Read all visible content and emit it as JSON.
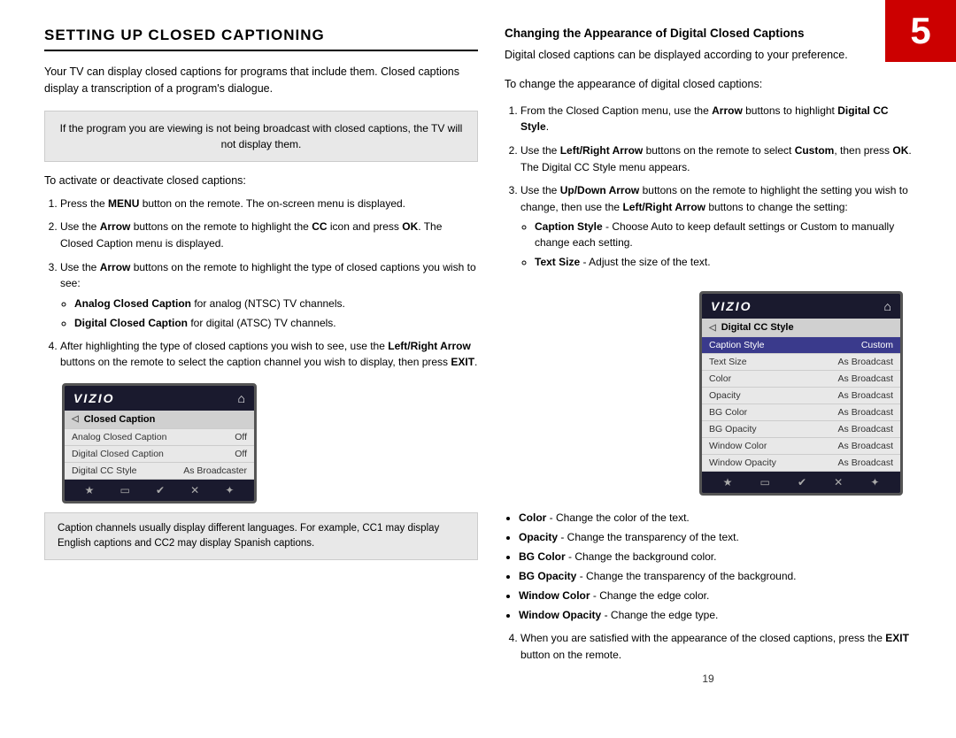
{
  "badge": {
    "number": "5"
  },
  "left": {
    "title": "SETTING UP CLOSED CAPTIONING",
    "intro": "Your TV can display closed captions for programs that include them. Closed captions display a transcription of a program's dialogue.",
    "info_box": "If the program you are viewing is not being broadcast with closed captions, the TV will not display them.",
    "steps_intro": "To activate or deactivate closed captions:",
    "steps": [
      {
        "id": 1,
        "text_parts": [
          {
            "text": "Press the ",
            "bold": false
          },
          {
            "text": "MENU",
            "bold": true
          },
          {
            "text": " button on the remote. The on-screen menu is displayed.",
            "bold": false
          }
        ]
      },
      {
        "id": 2,
        "text_parts": [
          {
            "text": "Use the ",
            "bold": false
          },
          {
            "text": "Arrow",
            "bold": true
          },
          {
            "text": " buttons on the remote to highlight the ",
            "bold": false
          },
          {
            "text": "CC",
            "bold": true
          },
          {
            "text": " icon and press ",
            "bold": false
          },
          {
            "text": "OK",
            "bold": true
          },
          {
            "text": ". The Closed Caption menu is displayed.",
            "bold": false
          }
        ]
      },
      {
        "id": 3,
        "text_parts": [
          {
            "text": "Use the ",
            "bold": false
          },
          {
            "text": "Arrow",
            "bold": true
          },
          {
            "text": " buttons on the remote to highlight the type of closed captions you wish to see:",
            "bold": false
          }
        ],
        "bullets": [
          {
            "bold_text": "Analog Closed Caption",
            "rest": " for analog (NTSC) TV channels."
          },
          {
            "bold_text": "Digital Closed Caption",
            "rest": " for digital (ATSC) TV channels."
          }
        ]
      },
      {
        "id": 4,
        "text_parts": [
          {
            "text": "After highlighting the type of closed captions you wish to see, use the ",
            "bold": false
          },
          {
            "text": "Left/Right Arrow",
            "bold": true
          },
          {
            "text": " buttons on the remote to select the caption channel you wish to display, then press ",
            "bold": false
          },
          {
            "text": "EXIT",
            "bold": true
          },
          {
            "text": ".",
            "bold": false
          }
        ]
      }
    ],
    "bottom_note": "Caption channels usually display different languages. For example, CC1 may display English captions and CC2 may display Spanish captions.",
    "tv_menu": {
      "logo": "VIZIO",
      "header_label": "Closed Caption",
      "rows": [
        {
          "label": "Analog Closed Caption",
          "value": "Off"
        },
        {
          "label": "Digital Closed Caption",
          "value": "Off"
        },
        {
          "label": "Digital CC Style",
          "value": "As Broadcaster"
        }
      ],
      "footer_icons": [
        "★",
        "▭",
        "✔",
        "✕",
        "✦"
      ]
    }
  },
  "right": {
    "heading": "Changing the Appearance of Digital Closed Captions",
    "intro1": "Digital closed captions can be displayed according to your preference.",
    "intro2": "To change the appearance of digital closed captions:",
    "steps": [
      {
        "id": 1,
        "text_parts": [
          {
            "text": "From the Closed Caption menu, use the ",
            "bold": false
          },
          {
            "text": "Arrow",
            "bold": true
          },
          {
            "text": " buttons to highlight ",
            "bold": false
          },
          {
            "text": "Digital CC Style",
            "bold": true
          },
          {
            "text": ".",
            "bold": false
          }
        ]
      },
      {
        "id": 2,
        "text_parts": [
          {
            "text": "Use the ",
            "bold": false
          },
          {
            "text": "Left/Right Arrow",
            "bold": true
          },
          {
            "text": " buttons on the remote to select ",
            "bold": false
          },
          {
            "text": "Custom",
            "bold": true
          },
          {
            "text": ", then press ",
            "bold": false
          },
          {
            "text": "OK",
            "bold": true
          },
          {
            "text": ". The Digital CC Style menu appears.",
            "bold": false
          }
        ]
      },
      {
        "id": 3,
        "text_parts": [
          {
            "text": "Use the ",
            "bold": false
          },
          {
            "text": "Up/Down Arrow",
            "bold": true
          },
          {
            "text": " buttons on the remote to highlight the setting you wish to change, then use the ",
            "bold": false
          },
          {
            "text": "Left/Right Arrow",
            "bold": true
          },
          {
            "text": " buttons to change the setting:",
            "bold": false
          }
        ],
        "bullets": [
          {
            "bold_text": "Caption Style",
            "rest": " - Choose Auto to keep default settings or Custom to manually change each setting."
          },
          {
            "bold_text": "Text Size",
            "rest": " - Adjust the size of the text."
          }
        ]
      }
    ],
    "extra_bullets": [
      {
        "bold_text": "Color",
        "rest": " - Change the color of the text."
      },
      {
        "bold_text": "Opacity",
        "rest": " - Change the transparency of the text."
      },
      {
        "bold_text": "BG Color",
        "rest": " - Change the background color."
      },
      {
        "bold_text": "BG Opacity",
        "rest": " - Change the transparency of the background."
      },
      {
        "bold_text": "Window Color",
        "rest": " - Change the edge color."
      },
      {
        "bold_text": "Window Opacity",
        "rest": " - Change the edge type."
      }
    ],
    "step4": {
      "id": 4,
      "text_parts": [
        {
          "text": "When you are satisfied with the appearance of the closed captions, press the ",
          "bold": false
        },
        {
          "text": "EXIT",
          "bold": true
        },
        {
          "text": " button on the remote.",
          "bold": false
        }
      ]
    },
    "tv_menu": {
      "logo": "VIZIO",
      "header_label": "Digital CC Style",
      "rows": [
        {
          "label": "Caption Style",
          "value": "Custom",
          "highlight": true
        },
        {
          "label": "Text Size",
          "value": "As Broadcast"
        },
        {
          "label": "Color",
          "value": "As Broadcast"
        },
        {
          "label": "Opacity",
          "value": "As Broadcast"
        },
        {
          "label": "BG Color",
          "value": "As Broadcast"
        },
        {
          "label": "BG Opacity",
          "value": "As Broadcast"
        },
        {
          "label": "Window Color",
          "value": "As Broadcast"
        },
        {
          "label": "Window Opacity",
          "value": "As Broadcast"
        }
      ],
      "footer_icons": [
        "★",
        "▭",
        "✔",
        "✕",
        "✦"
      ]
    },
    "page_number": "19"
  }
}
